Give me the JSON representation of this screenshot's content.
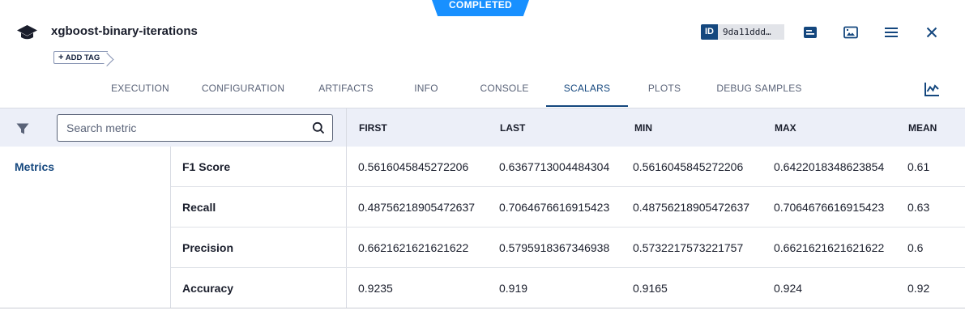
{
  "status": "COMPLETED",
  "task": {
    "title": "xgboost-binary-iterations",
    "add_tag_label": "ADD TAG",
    "id_label": "ID",
    "id_value": "9da11ddd…"
  },
  "header_icons": [
    "details-icon",
    "image-icon",
    "menu-icon",
    "close-icon"
  ],
  "tabs": [
    {
      "label": "EXECUTION",
      "active": false
    },
    {
      "label": "CONFIGURATION",
      "active": false
    },
    {
      "label": "ARTIFACTS",
      "active": false
    },
    {
      "label": "INFO",
      "active": false
    },
    {
      "label": "CONSOLE",
      "active": false
    },
    {
      "label": "SCALARS",
      "active": true
    },
    {
      "label": "PLOTS",
      "active": false
    },
    {
      "label": "DEBUG SAMPLES",
      "active": false
    }
  ],
  "search": {
    "placeholder": "Search metric",
    "value": ""
  },
  "columns": [
    "FIRST",
    "LAST",
    "MIN",
    "MAX",
    "MEAN"
  ],
  "group_label": "Metrics",
  "rows": [
    {
      "name": "F1 Score",
      "values": [
        "0.5616045845272206",
        "0.6367713004484304",
        "0.5616045845272206",
        "0.6422018348623854",
        "0.61"
      ]
    },
    {
      "name": "Recall",
      "values": [
        "0.48756218905472637",
        "0.7064676616915423",
        "0.48756218905472637",
        "0.7064676616915423",
        "0.63"
      ]
    },
    {
      "name": "Precision",
      "values": [
        "0.6621621621621622",
        "0.5795918367346938",
        "0.5732217573221757",
        "0.6621621621621622",
        "0.6"
      ]
    },
    {
      "name": "Accuracy",
      "values": [
        "0.9235",
        "0.919",
        "0.9165",
        "0.924",
        "0.92"
      ]
    }
  ],
  "colors": {
    "accent": "#14477e",
    "status_banner": "#1890ff",
    "header_band": "#eceff8"
  }
}
